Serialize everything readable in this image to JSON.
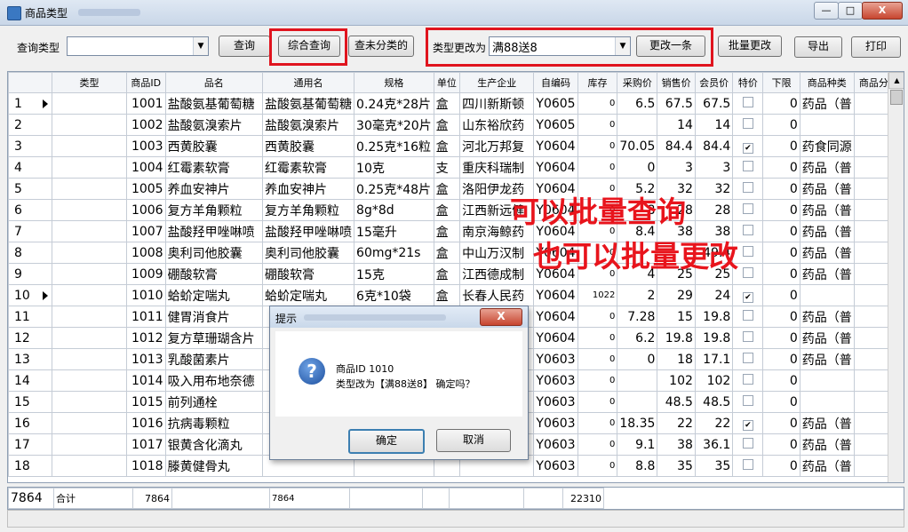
{
  "window": {
    "title": "商品类型",
    "min": "—",
    "max": "□",
    "close": "X"
  },
  "toolbar": {
    "query_type_label": "查询类型",
    "query_type_value": "",
    "query_button": "查询",
    "composite_query_button": "综合查询",
    "unclassified_button": "查未分类的",
    "change_type_label": "类型更改为",
    "change_type_value": "满88送8",
    "change_one_button": "更改一条",
    "batch_change_button": "批量更改",
    "export_button": "导出",
    "print_button": "打印"
  },
  "grid": {
    "columns": [
      "",
      "类型",
      "商品ID",
      "品名",
      "通用名",
      "规格",
      "单位",
      "生产企业",
      "自编码",
      "库存",
      "采购价",
      "销售价",
      "会员价",
      "特价",
      "下限",
      "商品种类",
      "商品分类"
    ],
    "rows": [
      {
        "n": "1",
        "id": "1001",
        "name": "盐酸氨基葡萄糖",
        "generic": "盐酸氨基葡萄糖",
        "spec": "0.24克*28片",
        "unit": "盒",
        "maker": "四川新斯顿",
        "code": "Y0605",
        "stock": "0",
        "buy": "6.5",
        "sale": "67.5",
        "member": "67.5",
        "special": false,
        "low": "0",
        "kind": "药品（普"
      },
      {
        "n": "2",
        "id": "1002",
        "name": "盐酸氨溴索片",
        "generic": "盐酸氨溴索片",
        "spec": "30毫克*20片",
        "unit": "盒",
        "maker": "山东裕欣药",
        "code": "Y0605",
        "stock": "0",
        "buy": "",
        "sale": "14",
        "member": "14",
        "special": false,
        "low": "0",
        "kind": ""
      },
      {
        "n": "3",
        "id": "1003",
        "name": "西黄胶囊",
        "generic": "西黄胶囊",
        "spec": "0.25克*16粒",
        "unit": "盒",
        "maker": "河北万邦复",
        "code": "Y0604",
        "stock": "0",
        "buy": "70.05",
        "sale": "84.4",
        "member": "84.4",
        "special": true,
        "low": "0",
        "kind": "药食同源"
      },
      {
        "n": "4",
        "id": "1004",
        "name": "红霉素软膏",
        "generic": "红霉素软膏",
        "spec": "10克",
        "unit": "支",
        "maker": "重庆科瑞制",
        "code": "Y0604",
        "stock": "0",
        "buy": "0",
        "sale": "3",
        "member": "3",
        "special": false,
        "low": "0",
        "kind": "药品（普"
      },
      {
        "n": "5",
        "id": "1005",
        "name": "养血安神片",
        "generic": "养血安神片",
        "spec": "0.25克*48片",
        "unit": "盒",
        "maker": "洛阳伊龙药",
        "code": "Y0604",
        "stock": "0",
        "buy": "5.2",
        "sale": "32",
        "member": "32",
        "special": false,
        "low": "0",
        "kind": "药品（普"
      },
      {
        "n": "6",
        "id": "1006",
        "name": "复方羊角颗粒",
        "generic": "复方羊角颗粒",
        "spec": "8g*8d",
        "unit": "盒",
        "maker": "江西新远健",
        "code": "Y0604",
        "stock": "0",
        "buy": "8",
        "sale": "28",
        "member": "28",
        "special": false,
        "low": "0",
        "kind": "药品（普"
      },
      {
        "n": "7",
        "id": "1007",
        "name": "盐酸羟甲唑啉喷",
        "generic": "盐酸羟甲唑啉喷",
        "spec": "15毫升",
        "unit": "盒",
        "maker": "南京海鲸药",
        "code": "Y0604",
        "stock": "0",
        "buy": "8.4",
        "sale": "38",
        "member": "38",
        "special": false,
        "low": "0",
        "kind": "药品（普"
      },
      {
        "n": "8",
        "id": "1008",
        "name": "奥利司他胶囊",
        "generic": "奥利司他胶囊",
        "spec": "60mg*21s",
        "unit": "盒",
        "maker": "中山万汉制",
        "code": "Y0604",
        "stock": "0",
        "buy": "",
        "sale": "",
        "member": "49.4",
        "special": false,
        "low": "0",
        "kind": "药品（普"
      },
      {
        "n": "9",
        "id": "1009",
        "name": "硼酸软膏",
        "generic": "硼酸软膏",
        "spec": "15克",
        "unit": "盒",
        "maker": "江西德成制",
        "code": "Y0604",
        "stock": "0",
        "buy": "4",
        "sale": "25",
        "member": "25",
        "special": false,
        "low": "0",
        "kind": "药品（普"
      },
      {
        "n": "10",
        "id": "1010",
        "name": "蛤蚧定喘丸",
        "generic": "蛤蚧定喘丸",
        "spec": "6克*10袋",
        "unit": "盒",
        "maker": "长春人民药",
        "code": "Y0604",
        "stock": "1022",
        "buy": "2",
        "sale": "29",
        "member": "24",
        "special": true,
        "low": "0",
        "kind": ""
      },
      {
        "n": "11",
        "id": "1011",
        "name": "健胃消食片",
        "generic": "",
        "spec": "",
        "unit": "",
        "maker": "",
        "code": "Y0604",
        "stock": "0",
        "buy": "7.28",
        "sale": "15",
        "member": "19.8",
        "special": false,
        "low": "0",
        "kind": "药品（普"
      },
      {
        "n": "12",
        "id": "1012",
        "name": "复方草珊瑚含片",
        "generic": "",
        "spec": "",
        "unit": "",
        "maker": "",
        "code": "Y0604",
        "stock": "0",
        "buy": "6.2",
        "sale": "19.8",
        "member": "19.8",
        "special": false,
        "low": "0",
        "kind": "药品（普"
      },
      {
        "n": "13",
        "id": "1013",
        "name": "乳酸菌素片",
        "generic": "",
        "spec": "",
        "unit": "",
        "maker": "",
        "code": "Y0603",
        "stock": "0",
        "buy": "0",
        "sale": "18",
        "member": "17.1",
        "special": false,
        "low": "0",
        "kind": "药品（普"
      },
      {
        "n": "14",
        "id": "1014",
        "name": "吸入用布地奈德",
        "generic": "",
        "spec": "",
        "unit": "",
        "maker": "",
        "code": "Y0603",
        "stock": "0",
        "buy": "",
        "sale": "102",
        "member": "102",
        "special": false,
        "low": "0",
        "kind": ""
      },
      {
        "n": "15",
        "id": "1015",
        "name": "前列通栓",
        "generic": "",
        "spec": "",
        "unit": "",
        "maker": "",
        "code": "Y0603",
        "stock": "0",
        "buy": "",
        "sale": "48.5",
        "member": "48.5",
        "special": false,
        "low": "0",
        "kind": ""
      },
      {
        "n": "16",
        "id": "1016",
        "name": "抗病毒颗粒",
        "generic": "",
        "spec": "",
        "unit": "",
        "maker": "",
        "code": "Y0603",
        "stock": "0",
        "buy": "18.35",
        "sale": "22",
        "member": "22",
        "special": true,
        "low": "0",
        "kind": "药品（普"
      },
      {
        "n": "17",
        "id": "1017",
        "name": "银黄含化滴丸",
        "generic": "",
        "spec": "",
        "unit": "",
        "maker": "",
        "code": "Y0603",
        "stock": "0",
        "buy": "9.1",
        "sale": "38",
        "member": "36.1",
        "special": false,
        "low": "0",
        "kind": "药品（普"
      },
      {
        "n": "18",
        "id": "1018",
        "name": "滕黄健骨丸",
        "generic": "",
        "spec": "",
        "unit": "",
        "maker": "",
        "code": "Y0603",
        "stock": "0",
        "buy": "8.8",
        "sale": "35",
        "member": "35",
        "special": false,
        "low": "0",
        "kind": "药品（普"
      }
    ]
  },
  "footer": {
    "count": "7864",
    "label": "合计",
    "id_total": "7864",
    "generic_total": "7864",
    "stock_total": "22310"
  },
  "overlay": {
    "line1": "可以批量查询",
    "line2": "也可以批量更改"
  },
  "dialog": {
    "title": "提示",
    "close": "X",
    "line1": "商品ID 1010",
    "line2": "类型改为【满88送8】 确定吗？",
    "ok": "确定",
    "cancel": "取消",
    "icon": "?"
  },
  "colors": {
    "highlight_frame": "#e0141e",
    "overlay_text": "#e8141c"
  }
}
